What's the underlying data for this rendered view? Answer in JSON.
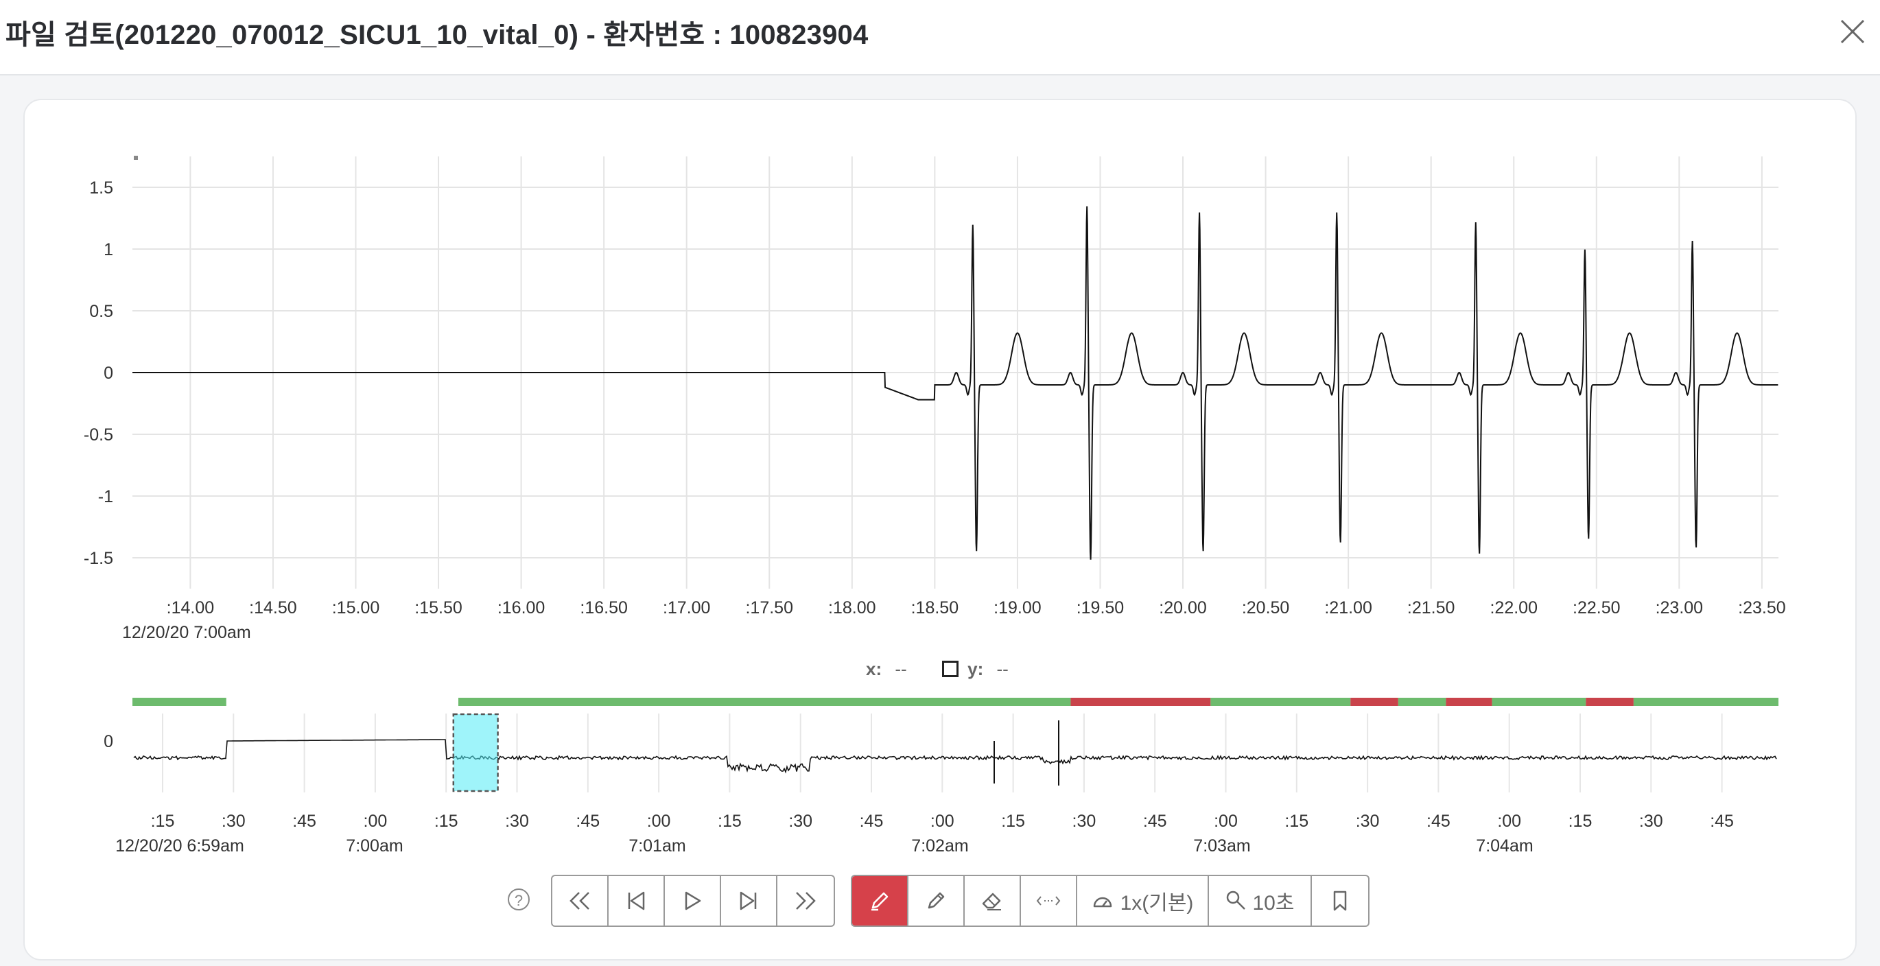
{
  "header": {
    "title": "파일 검토(201220_070012_SICU1_10_vital_0) - 환자번호 : 100823904"
  },
  "main_chart": {
    "y_ticks": [
      "1.5",
      "1",
      "0.5",
      "0",
      "-0.5",
      "-1",
      "-1.5"
    ],
    "x_ticks": [
      ":14.00",
      ":14.50",
      ":15.00",
      ":15.50",
      ":16.00",
      ":16.50",
      ":17.00",
      ":17.50",
      ":18.00",
      ":18.50",
      ":19.00",
      ":19.50",
      ":20.00",
      ":20.50",
      ":21.00",
      ":21.50",
      ":22.00",
      ":22.50",
      ":23.00",
      ":23.50"
    ],
    "date_label": "12/20/20 7:00am"
  },
  "readout": {
    "x_label": "x:",
    "x_value": "--",
    "y_label": "y:",
    "y_value": "--"
  },
  "overview": {
    "y_tick": "0",
    "x_ticks": [
      ":15",
      ":30",
      ":45",
      ":00",
      ":15",
      ":30",
      ":45",
      ":00",
      ":15",
      ":30",
      ":45",
      ":00",
      ":15",
      ":30",
      ":45",
      ":00",
      ":15",
      ":30",
      ":45",
      ":00",
      ":15",
      ":30",
      ":45"
    ],
    "hour_labels": [
      "12/20/20 6:59am",
      "7:00am",
      "7:01am",
      "7:02am",
      "7:03am",
      "7:04am"
    ]
  },
  "toolbar": {
    "speed_label": "1x(기본)",
    "zoom_label": "10초"
  },
  "chart_data": [
    {
      "type": "line",
      "title": "",
      "x_range_seconds": [
        13.65,
        23.6
      ],
      "ylim": [
        -1.75,
        1.75
      ],
      "series": [
        {
          "flat_until": 18.2,
          "baseline": 0.0,
          "r_peaks": [
            {
              "t": 18.73,
              "r": 1.3,
              "s": -1.35
            },
            {
              "t": 19.42,
              "r": 1.45,
              "s": -1.42
            },
            {
              "t": 20.1,
              "r": 1.4,
              "s": -1.35
            },
            {
              "t": 20.93,
              "r": 1.4,
              "s": -1.28
            },
            {
              "t": 21.77,
              "r": 1.32,
              "s": -1.37
            },
            {
              "t": 22.43,
              "r": 1.1,
              "s": -1.25
            },
            {
              "t": 23.08,
              "r": 1.17,
              "s": -1.32
            }
          ]
        }
      ],
      "grid": true
    },
    {
      "type": "line",
      "title": "",
      "quality_segments": [
        {
          "from": 0.0,
          "to": 0.057,
          "color": "#6dbb6d"
        },
        {
          "from": 0.198,
          "to": 0.57,
          "color": "#6dbb6d"
        },
        {
          "from": 0.57,
          "to": 0.655,
          "color": "#c9434b"
        },
        {
          "from": 0.655,
          "to": 0.74,
          "color": "#6dbb6d"
        },
        {
          "from": 0.74,
          "to": 0.769,
          "color": "#c9434b"
        },
        {
          "from": 0.769,
          "to": 0.798,
          "color": "#6dbb6d"
        },
        {
          "from": 0.798,
          "to": 0.826,
          "color": "#c9434b"
        },
        {
          "from": 0.826,
          "to": 0.883,
          "color": "#6dbb6d"
        },
        {
          "from": 0.883,
          "to": 0.912,
          "color": "#c9434b"
        },
        {
          "from": 0.912,
          "to": 1.0,
          "color": "#6dbb6d"
        }
      ],
      "selection": {
        "from": 0.195,
        "to": 0.222
      }
    }
  ]
}
